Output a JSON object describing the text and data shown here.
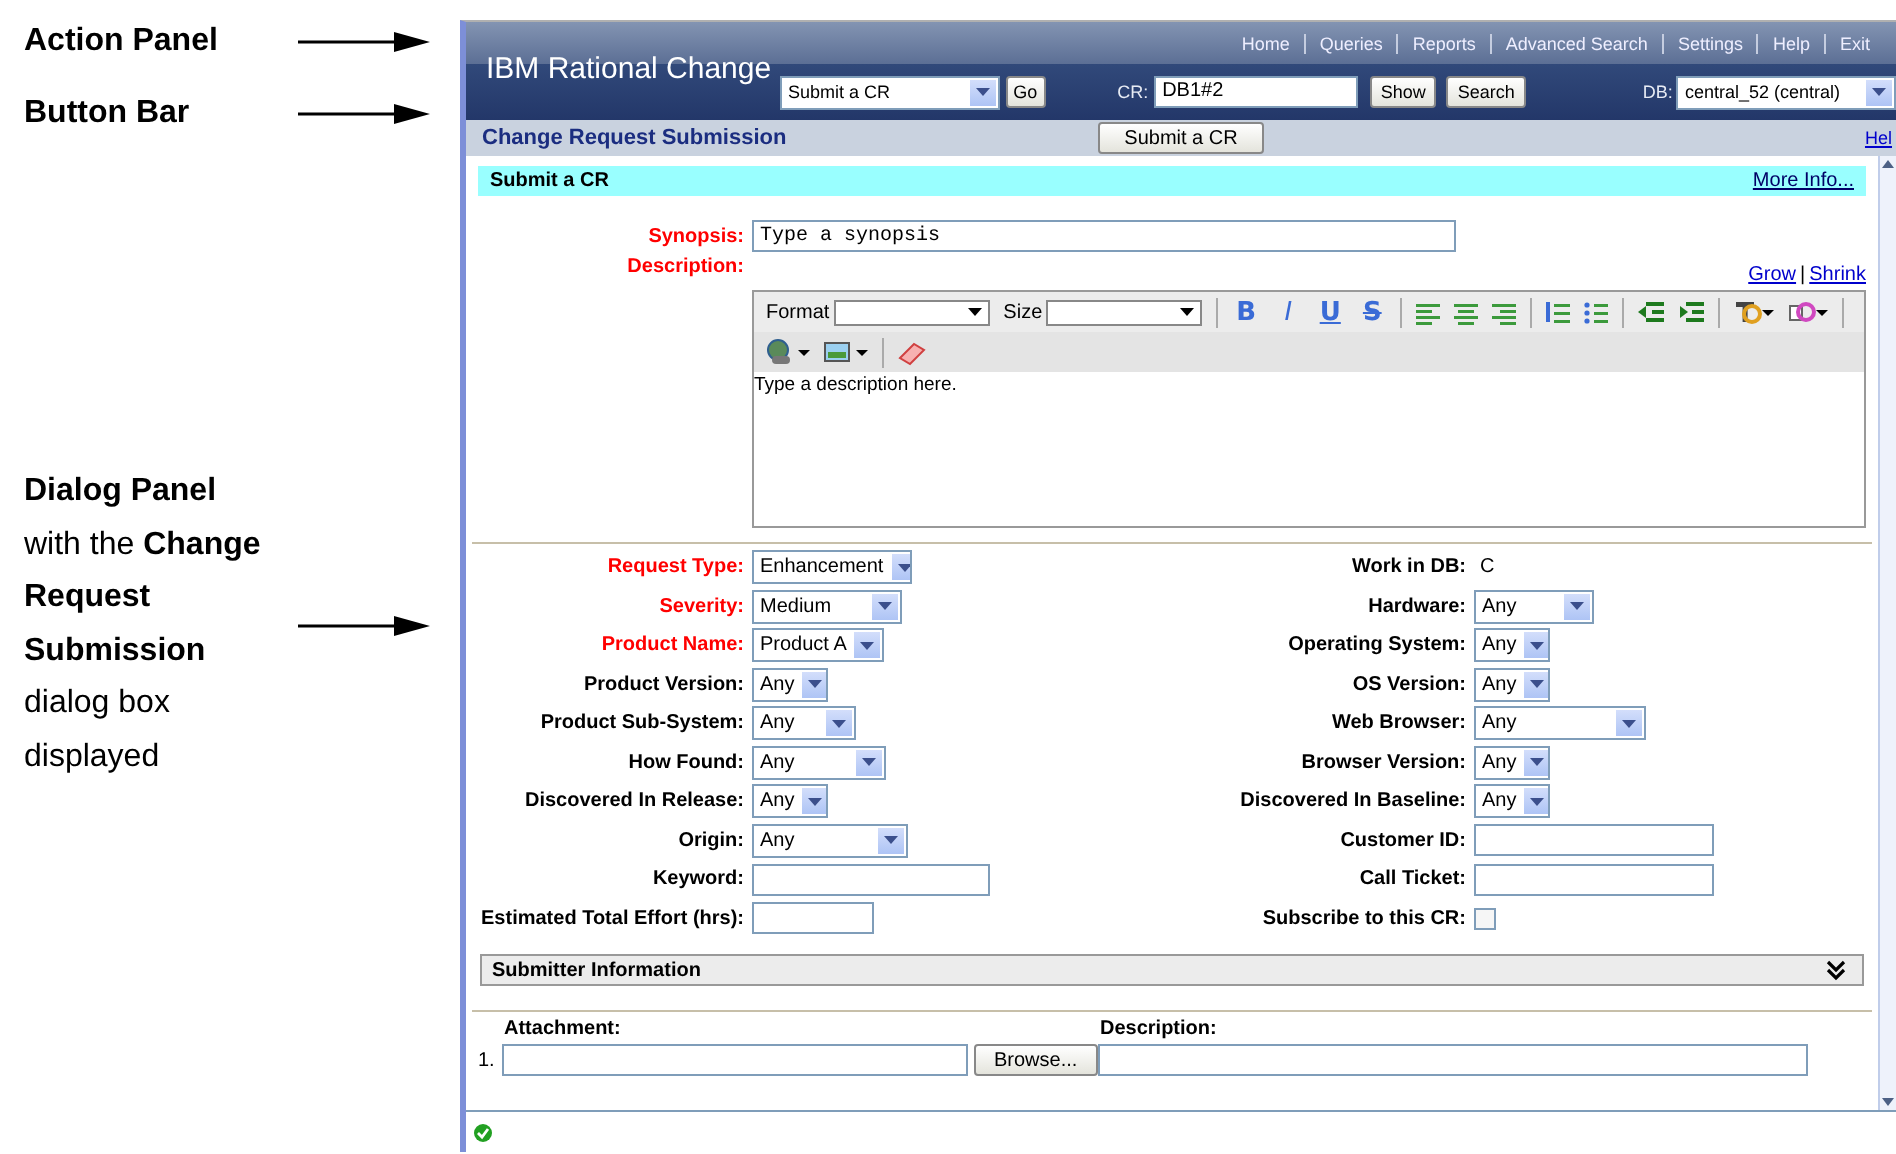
{
  "annotations": [
    {
      "kind": "heading",
      "text": "Action Panel"
    },
    {
      "kind": "heading",
      "text": "Button Bar"
    },
    {
      "kind": "paragraph",
      "text": "**Dialog Panel** with the **Change Request Submission** dialog box displayed"
    }
  ],
  "header": {
    "title": "IBM Rational Change",
    "nav_links": [
      "Home",
      "Queries",
      "Reports",
      "Advanced Search",
      "Settings",
      "Help",
      "Exit"
    ],
    "action_select": "Submit a CR",
    "go_button": "Go",
    "cr_label": "CR:",
    "cr_value": "DB1#2",
    "show_button": "Show",
    "search_button": "Search",
    "db_label": "DB:",
    "db_select": "central_52 (central)"
  },
  "button_bar": {
    "title": "Change Request Submission",
    "submit_button": "Submit a CR",
    "help_link": "Hel"
  },
  "dialog": {
    "section_title": "Submit a CR",
    "more_info": "More Info...",
    "synopsis": {
      "label": "Synopsis:",
      "required": true,
      "value": "Type a synopsis"
    },
    "description": {
      "label": "Description:",
      "required": true,
      "grow": "Grow",
      "separator": "|",
      "shrink": "Shrink",
      "format_label": "Format",
      "size_label": "Size",
      "value": "Type a description here.",
      "format_buttons": [
        {
          "glyph": "B",
          "kind": "bold"
        },
        {
          "glyph": "I",
          "kind": "italic"
        },
        {
          "glyph": "U",
          "kind": "underline"
        },
        {
          "glyph": "S",
          "kind": "strike"
        }
      ]
    },
    "left_fields": [
      {
        "label": "Request Type:",
        "required": true,
        "kind": "select",
        "value": "Enhancement"
      },
      {
        "label": "Severity:",
        "required": true,
        "kind": "select",
        "value": "Medium"
      },
      {
        "label": "Product Name:",
        "required": true,
        "kind": "select",
        "value": "Product A"
      },
      {
        "label": "Product Version:",
        "required": false,
        "kind": "select",
        "value": "Any"
      },
      {
        "label": "Product Sub-System:",
        "required": false,
        "kind": "select",
        "value": "Any"
      },
      {
        "label": "How Found:",
        "required": false,
        "kind": "select",
        "value": "Any"
      },
      {
        "label": "Discovered In Release:",
        "required": false,
        "kind": "select",
        "value": "Any"
      },
      {
        "label": "Origin:",
        "required": false,
        "kind": "select",
        "value": "Any"
      },
      {
        "label": "Keyword:",
        "required": false,
        "kind": "text"
      },
      {
        "label": "Estimated Total Effort (hrs):",
        "required": false,
        "kind": "text"
      }
    ],
    "right_fields": [
      {
        "label": "Work in DB:",
        "required": false,
        "kind": "static",
        "value": "C"
      },
      {
        "label": "Hardware:",
        "required": false,
        "kind": "select",
        "value": "Any"
      },
      {
        "label": "Operating System:",
        "required": false,
        "kind": "select",
        "value": "Any"
      },
      {
        "label": "OS Version:",
        "required": false,
        "kind": "select",
        "value": "Any"
      },
      {
        "label": "Web Browser:",
        "required": false,
        "kind": "select",
        "value": "Any"
      },
      {
        "label": "Browser Version:",
        "required": false,
        "kind": "select",
        "value": "Any"
      },
      {
        "label": "Discovered In Baseline:",
        "required": false,
        "kind": "select",
        "value": "Any"
      },
      {
        "label": "Customer ID:",
        "required": false,
        "kind": "text"
      },
      {
        "label": "Call Ticket:",
        "required": false,
        "kind": "text"
      },
      {
        "label": "Subscribe to this CR:",
        "required": false,
        "kind": "checkbox",
        "checked": false
      }
    ],
    "submitter": {
      "title": "Submitter Information",
      "expanded": false
    },
    "attachments": {
      "attachment_label": "Attachment:",
      "description_label": "Description:",
      "rows": [
        {
          "number": "1.",
          "browse_button": "Browse..."
        }
      ]
    }
  }
}
